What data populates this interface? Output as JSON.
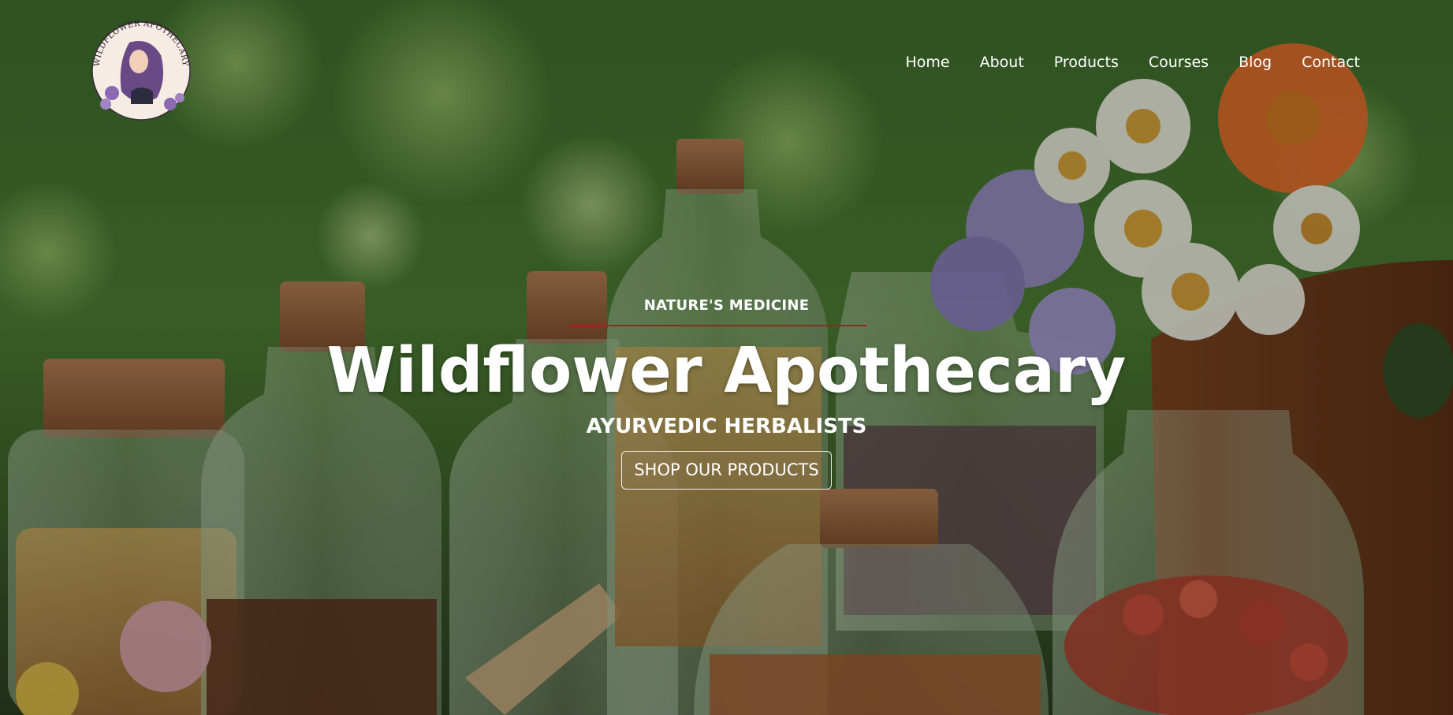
{
  "brand": {
    "logo_text": "WILDFLOWER APOTHECARY",
    "logo_icon": "woman-with-flowers-logo"
  },
  "nav": {
    "items": [
      {
        "label": "Home"
      },
      {
        "label": "About"
      },
      {
        "label": "Products"
      },
      {
        "label": "Courses"
      },
      {
        "label": "Blog"
      },
      {
        "label": "Contact"
      }
    ]
  },
  "hero": {
    "eyebrow": "NATURE'S MEDICINE",
    "title": "Wildflower Apothecary",
    "subtitle": "AYURVEDIC HERBALISTS",
    "cta_label": "SHOP OUR PRODUCTS",
    "background": "glass-apothecary-bottles-and-wildflowers"
  },
  "colors": {
    "accent_line": "#c0121a",
    "text": "#ffffff",
    "foliage": "#3f6b2c"
  }
}
